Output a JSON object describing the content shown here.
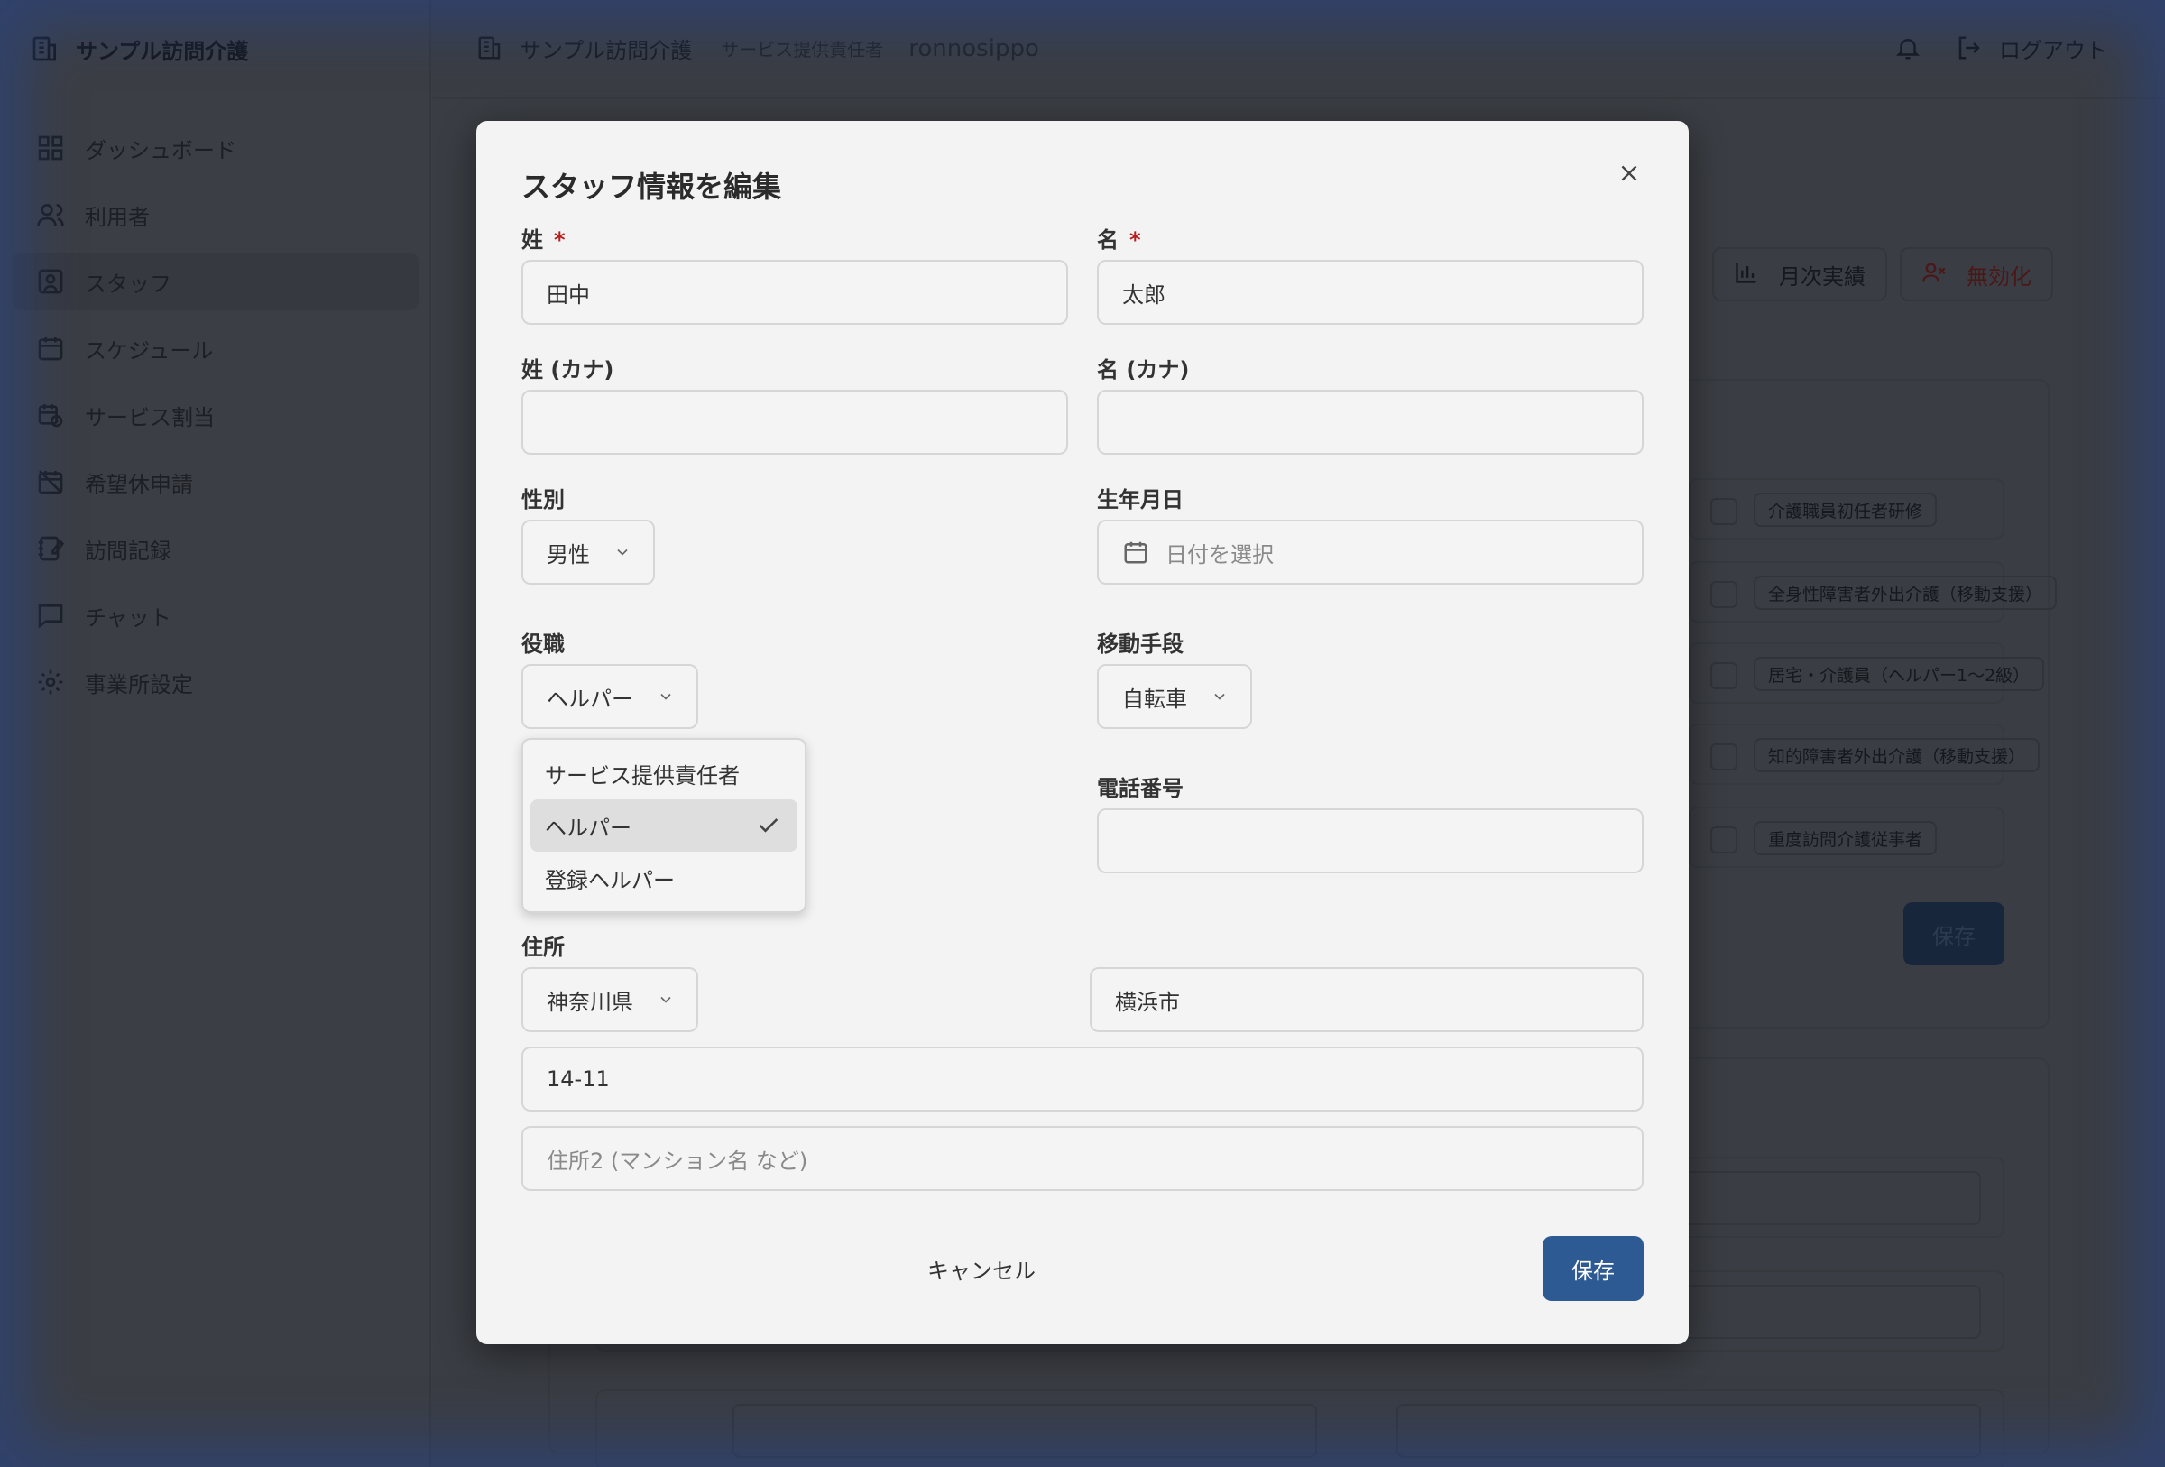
{
  "app": {
    "brand_name": "サンプル訪問介護",
    "sidebar": {
      "items": [
        {
          "label": "ダッシュボード",
          "icon": "dashboard-icon"
        },
        {
          "label": "利用者",
          "icon": "users-icon"
        },
        {
          "label": "スタッフ",
          "icon": "staff-icon"
        },
        {
          "label": "スケジュール",
          "icon": "calendar-icon"
        },
        {
          "label": "サービス割当",
          "icon": "calendar-clock-icon"
        },
        {
          "label": "希望休申請",
          "icon": "calendar-off-icon"
        },
        {
          "label": "訪問記録",
          "icon": "notebook-pen-icon"
        },
        {
          "label": "チャット",
          "icon": "chat-icon"
        },
        {
          "label": "事業所設定",
          "icon": "gear-icon"
        }
      ],
      "active_index": 2
    },
    "header": {
      "org_name": "サンプル訪問介護",
      "role": "サービス提供責任者",
      "username": "ronnosippo",
      "logout_label": "ログアウト"
    },
    "background_page": {
      "monthly_label": "月次実績",
      "deactivate_label": "無効化",
      "qualifications": [
        "介護職員初任者研修",
        "全身性障害者外出介護（移動支援）",
        "居宅・介護員（ヘルパー1〜2級）",
        "知的障害者外出介護（移動支援）",
        "重度訪問介護従事者"
      ],
      "save_label": "保存"
    }
  },
  "modal": {
    "title": "スタッフ情報を編集",
    "fields": {
      "last_name": {
        "label": "姓",
        "value": "田中",
        "required": "*"
      },
      "first_name": {
        "label": "名",
        "value": "太郎",
        "required": "*"
      },
      "last_name_kana": {
        "label": "姓 (カナ)",
        "value": ""
      },
      "first_name_kana": {
        "label": "名 (カナ)",
        "value": ""
      },
      "gender": {
        "label": "性別",
        "value": "男性"
      },
      "birthdate": {
        "label": "生年月日",
        "placeholder": "日付を選択"
      },
      "position": {
        "label": "役職",
        "value": "ヘルパー"
      },
      "transport": {
        "label": "移動手段",
        "value": "自転車"
      },
      "phone": {
        "label": "電話番号",
        "value": ""
      },
      "address": {
        "label": "住所",
        "prefecture": "神奈川県",
        "city": "横浜市",
        "street": "14-11",
        "line2_placeholder": "住所2 (マンション名 など)"
      }
    },
    "position_options": [
      {
        "label": "サービス提供責任者",
        "selected": false
      },
      {
        "label": "ヘルパー",
        "selected": true
      },
      {
        "label": "登録ヘルパー",
        "selected": false
      }
    ],
    "cancel_label": "キャンセル",
    "save_label": "保存"
  },
  "colors": {
    "primary": "#2e5a94",
    "required": "#b91c1c",
    "overlay": "#3a3d43"
  }
}
